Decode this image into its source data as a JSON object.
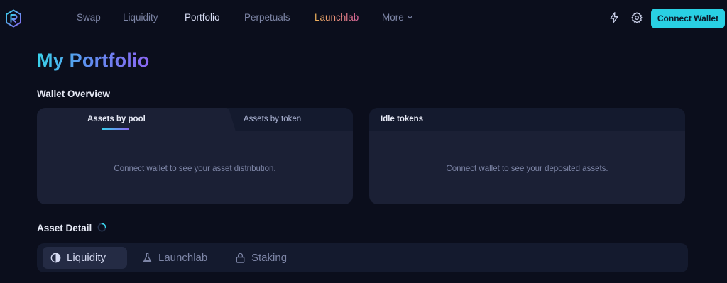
{
  "nav": {
    "items": [
      {
        "label": "Swap"
      },
      {
        "label": "Liquidity"
      },
      {
        "label": "Portfolio",
        "active": true
      },
      {
        "label": "Perpetuals"
      },
      {
        "label": "Launchlab"
      },
      {
        "label": "More"
      }
    ],
    "connect_wallet": "Connect Wallet",
    "icons": [
      "logo-icon",
      "lightning-icon",
      "gear-icon",
      "chevron-down-icon"
    ]
  },
  "page": {
    "title": "My Portfolio"
  },
  "wallet_overview": {
    "title": "Wallet Overview",
    "tabs": [
      {
        "label": "Assets by pool",
        "active": true
      },
      {
        "label": "Assets by token"
      }
    ],
    "assets_empty": "Connect wallet to see your asset distribution.",
    "idle_title": "Idle tokens",
    "idle_empty": "Connect wallet to see your deposited assets."
  },
  "asset_detail": {
    "title": "Asset Detail",
    "tabs": [
      {
        "label": "Liquidity",
        "icon": "liquidity-icon",
        "active": true
      },
      {
        "label": "Launchlab",
        "icon": "flask-icon"
      },
      {
        "label": "Staking",
        "icon": "lock-icon"
      }
    ]
  },
  "colors": {
    "background": "#0b0e1c",
    "card": "#1b2035",
    "accent": "#29d0e3",
    "muted_text": "#7d85a6"
  }
}
